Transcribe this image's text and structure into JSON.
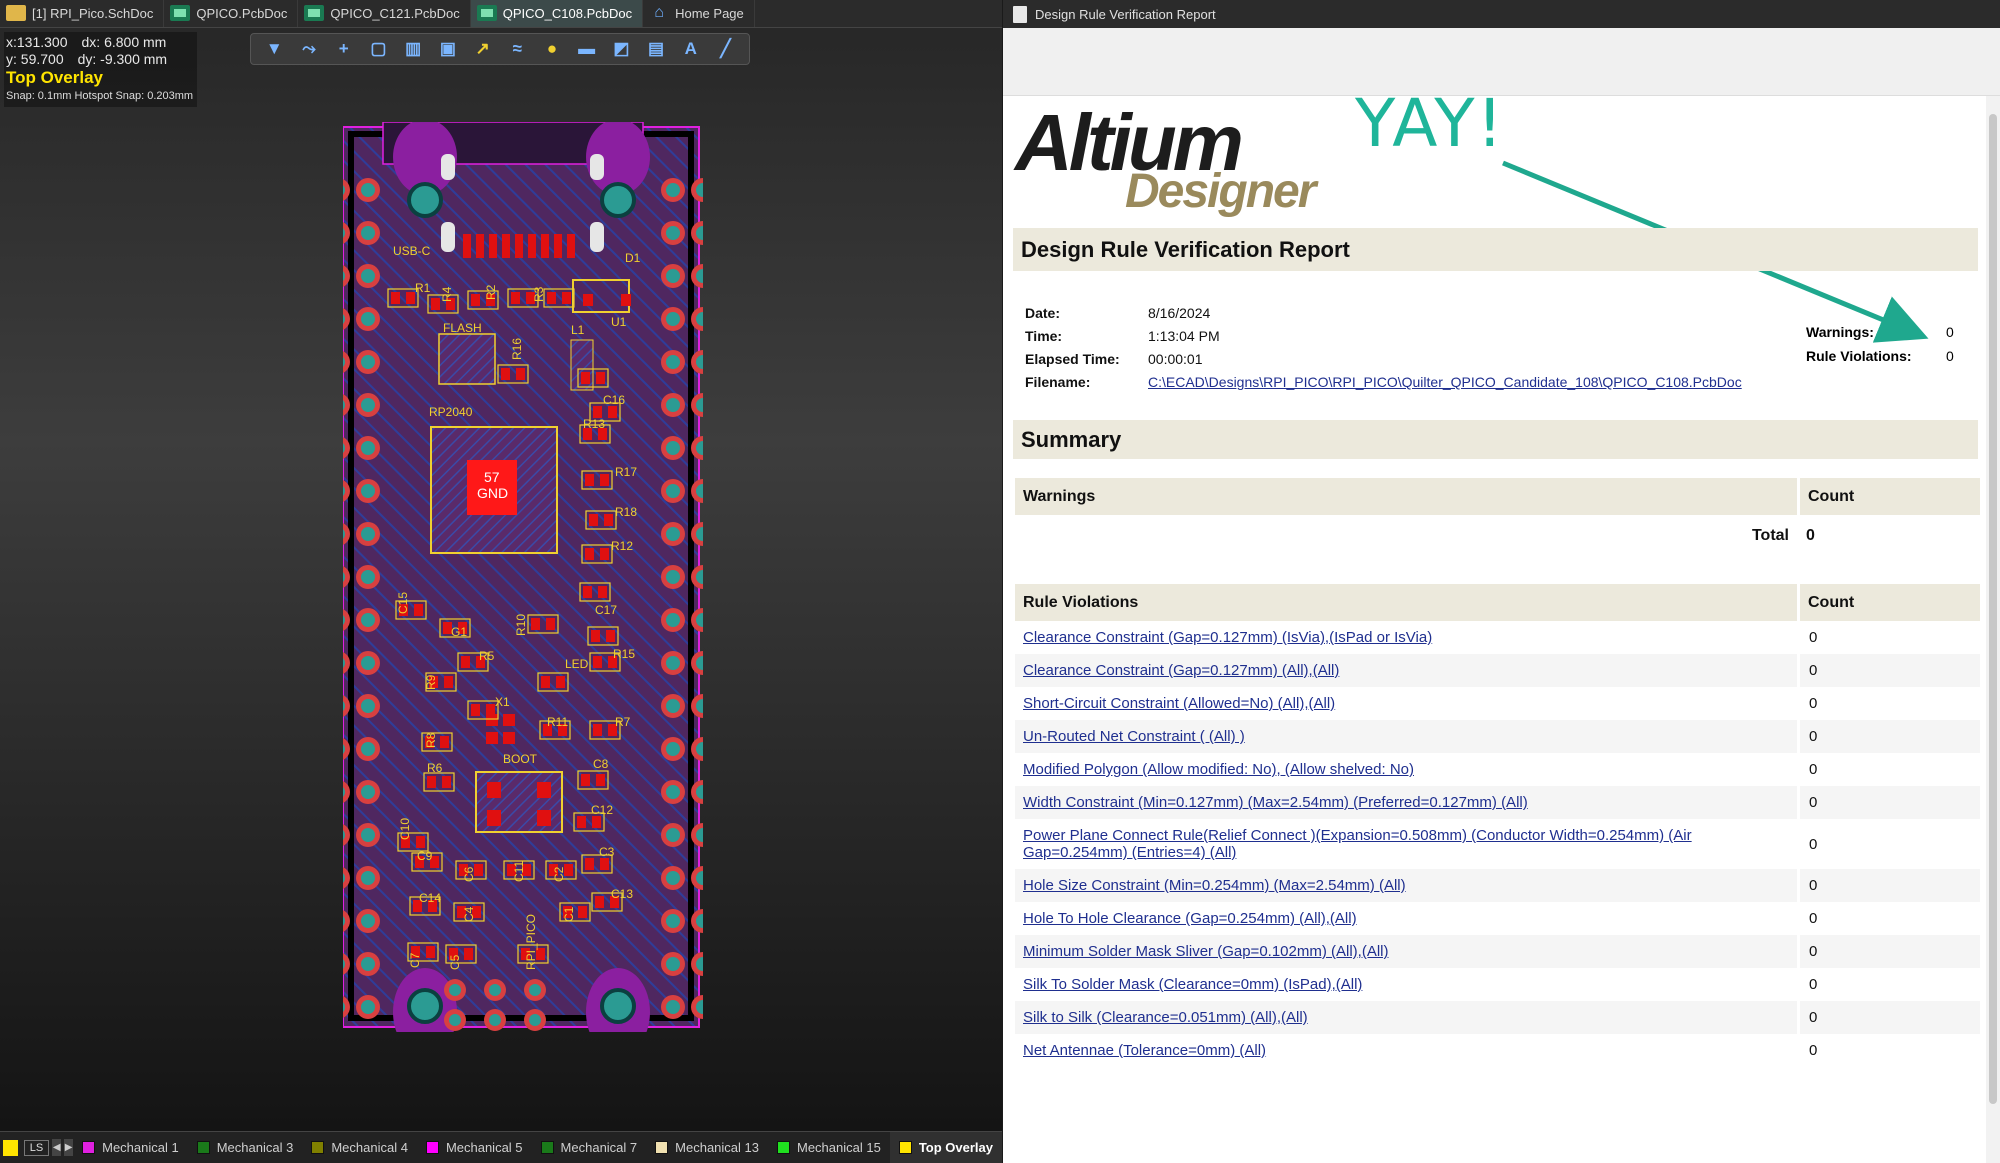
{
  "left_tabs": [
    {
      "label": "[1] RPI_Pico.SchDoc",
      "icon": "schematic-icon"
    },
    {
      "label": "QPICO.PcbDoc",
      "icon": "pcb-icon"
    },
    {
      "label": "QPICO_C121.PcbDoc",
      "icon": "pcb-icon"
    },
    {
      "label": "QPICO_C108.PcbDoc",
      "icon": "pcb-icon"
    },
    {
      "label": "Home Page",
      "icon": "home-icon"
    }
  ],
  "coords": {
    "x": "x:131.300",
    "dx": "dx:  6.800 mm",
    "y": "y: 59.700",
    "dy": "dy: -9.300 mm",
    "layer": "Top Overlay",
    "snap": "Snap: 0.1mm Hotspot Snap: 0.203mm"
  },
  "toolbar_icons": [
    "filter-icon",
    "route-icon",
    "cross-icon",
    "select-rect-icon",
    "chart-icon",
    "component-icon",
    "interactive-route-icon",
    "diff-pair-icon",
    "via-icon",
    "fill-icon",
    "polygon-icon",
    "dimension-icon",
    "text-icon",
    "line-icon"
  ],
  "board": {
    "silk": {
      "usb": "USB-C",
      "d1": "D1",
      "r1": "R1",
      "r4": "R4",
      "r2": "R2",
      "r3": "R3",
      "flash": "FLASH",
      "r16": "R16",
      "l1": "L1",
      "u1": "U1",
      "c16": "C16",
      "rp2040": "RP2040",
      "r13": "R13",
      "gnd_num": "57",
      "gnd": "GND",
      "r17": "R17",
      "r18": "R18",
      "r12": "R12",
      "c15": "C15",
      "g1": "G1",
      "r10": "R10",
      "c17": "C17",
      "r5": "R5",
      "r15": "R15",
      "r9": "R9",
      "led": "LED",
      "x1": "X1",
      "r11": "R11",
      "r7": "R7",
      "r8": "R8",
      "boot": "BOOT",
      "r6": "R6",
      "c8": "C8",
      "c12": "C12",
      "c10": "C10",
      "c9": "C9",
      "c6": "C6",
      "c11": "C11",
      "c2": "C2",
      "c3": "C3",
      "c14": "C14",
      "c4": "C4",
      "c13": "C13",
      "c1": "C1",
      "c7": "C7",
      "c5": "C5",
      "rpi": "RPI_PICO"
    }
  },
  "layer_bar": {
    "ls": "LS",
    "layers": [
      {
        "label": "Mechanical 1",
        "color": "#e020e0"
      },
      {
        "label": "Mechanical 3",
        "color": "#1a7a1a"
      },
      {
        "label": "Mechanical 4",
        "color": "#808000"
      },
      {
        "label": "Mechanical 5",
        "color": "#ff00ff"
      },
      {
        "label": "Mechanical 7",
        "color": "#1a7a1a"
      },
      {
        "label": "Mechanical 13",
        "color": "#f0e0b0"
      },
      {
        "label": "Mechanical 15",
        "color": "#20e020"
      },
      {
        "label": "Top Overlay",
        "color": "#ffe400",
        "active": true
      }
    ]
  },
  "report": {
    "window_title": "Design Rule Verification Report",
    "logo_main": "Altium",
    "logo_sub": "Designer",
    "annotation": "YAY!",
    "title": "Design Rule Verification Report",
    "meta": [
      {
        "k": "Date:",
        "v": "8/16/2024"
      },
      {
        "k": "Time:",
        "v": "1:13:04 PM"
      },
      {
        "k": "Elapsed Time:",
        "v": "00:00:01"
      },
      {
        "k": "Filename:",
        "v": "C:\\ECAD\\Designs\\RPI_PICO\\RPI_PICO\\Quilter_QPICO_Candidate_108\\QPICO_C108.PcbDoc",
        "link": true
      }
    ],
    "warnings_label": "Warnings:",
    "warnings_value": "0",
    "violations_label": "Rule Violations:",
    "violations_value": "0",
    "summary": "Summary",
    "warnings_table": {
      "col1": "Warnings",
      "col2": "Count",
      "total_label": "Total",
      "total_value": "0"
    },
    "violations_table": {
      "col1": "Rule Violations",
      "col2": "Count",
      "rows": [
        {
          "rule": "Clearance Constraint (Gap=0.127mm) (IsVia),(IsPad or IsVia)",
          "count": "0"
        },
        {
          "rule": "Clearance Constraint (Gap=0.127mm) (All),(All)",
          "count": "0"
        },
        {
          "rule": "Short-Circuit Constraint (Allowed=No) (All),(All)",
          "count": "0"
        },
        {
          "rule": "Un-Routed Net Constraint ( (All) )",
          "count": "0"
        },
        {
          "rule": "Modified Polygon (Allow modified: No), (Allow shelved: No)",
          "count": "0"
        },
        {
          "rule": "Width Constraint (Min=0.127mm) (Max=2.54mm) (Preferred=0.127mm) (All)",
          "count": "0"
        },
        {
          "rule": "Power Plane Connect Rule(Relief Connect )(Expansion=0.508mm) (Conductor Width=0.254mm) (Air Gap=0.254mm) (Entries=4) (All)",
          "count": "0"
        },
        {
          "rule": "Hole Size Constraint (Min=0.254mm) (Max=2.54mm) (All)",
          "count": "0"
        },
        {
          "rule": "Hole To Hole Clearance (Gap=0.254mm) (All),(All)",
          "count": "0"
        },
        {
          "rule": "Minimum Solder Mask Sliver (Gap=0.102mm) (All),(All)",
          "count": "0"
        },
        {
          "rule": "Silk To Solder Mask (Clearance=0mm) (IsPad),(All)",
          "count": "0"
        },
        {
          "rule": "Silk to Silk (Clearance=0.051mm) (All),(All)",
          "count": "0"
        },
        {
          "rule": "Net Antennae (Tolerance=0mm) (All)",
          "count": "0"
        }
      ]
    }
  }
}
